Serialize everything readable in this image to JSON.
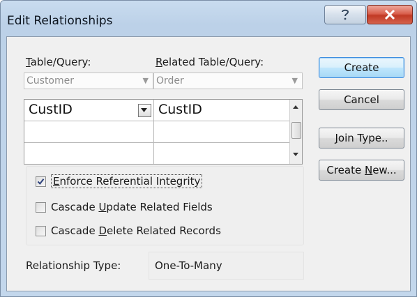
{
  "window": {
    "title": "Edit Relationships"
  },
  "labels": {
    "table_query_prefix": "T",
    "table_query_rest": "able/Query:",
    "related_prefix": "R",
    "related_rest": "elated Table/Query:",
    "relationship_type": "Relationship Type:"
  },
  "combos": {
    "table": {
      "value": "Customer"
    },
    "related": {
      "value": "Order"
    }
  },
  "grid": {
    "rows": [
      {
        "left": "CustID",
        "right": "CustID"
      },
      {
        "left": "",
        "right": ""
      },
      {
        "left": "",
        "right": ""
      }
    ]
  },
  "options": {
    "enforce": {
      "prefix": "E",
      "rest": "nforce Referential Integrity",
      "checked": true
    },
    "cascade_update": {
      "before": "Cascade ",
      "key": "U",
      "after": "pdate Related Fields",
      "checked": false
    },
    "cascade_delete": {
      "before": "Cascade ",
      "key": "D",
      "after": "elete Related Records",
      "checked": false
    }
  },
  "relationship_type": "One-To-Many",
  "buttons": {
    "create": "Create",
    "cancel": "Cancel",
    "join_key": "J",
    "join_rest": "oin Type..",
    "create_new_before": "Create ",
    "create_new_key": "N",
    "create_new_after": "ew..."
  },
  "colors": {
    "accent": "#3d8ee0",
    "close": "#c13a25"
  }
}
